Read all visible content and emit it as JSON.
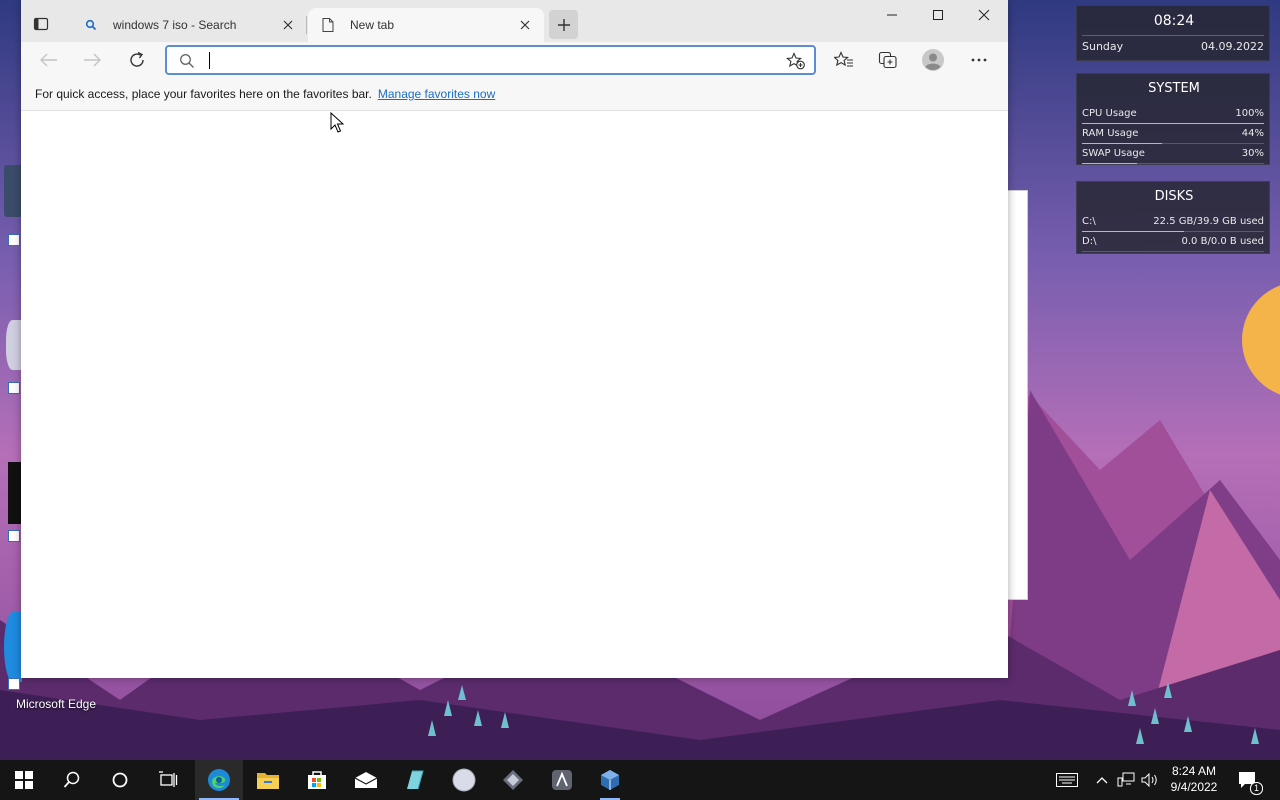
{
  "browser": {
    "tabs": [
      {
        "title": "windows 7 iso - Search",
        "icon": "search-icon"
      },
      {
        "title": "New tab",
        "icon": "page-icon"
      }
    ],
    "address": {
      "value": "",
      "placeholder": ""
    },
    "favorites_bar": {
      "message": "For quick access, place your favorites here on the favorites bar.",
      "link": "Manage favorites now"
    },
    "accent": "#5b8ed0"
  },
  "widgets": {
    "clock": {
      "time": "08:24",
      "day": "Sunday",
      "date": "04.09.2022"
    },
    "system": {
      "title": "SYSTEM",
      "rows": [
        {
          "label": "CPU Usage",
          "value": "100%",
          "level": 1.0
        },
        {
          "label": "RAM Usage",
          "value": "44%",
          "level": 0.44
        },
        {
          "label": "SWAP Usage",
          "value": "30%",
          "level": 0.3
        }
      ]
    },
    "disks": {
      "title": "DISKS",
      "rows": [
        {
          "label": "C:\\",
          "value": "22.5 GB/39.9 GB used",
          "level": 0.56
        },
        {
          "label": "D:\\",
          "value": "0.0 B/0.0 B used",
          "level": 0.0
        }
      ]
    }
  },
  "desktop": {
    "edge_label": "Microsoft Edge"
  },
  "taskbar": {
    "pinned": [
      "start-icon",
      "search-icon",
      "cortana-icon",
      "task-view-icon",
      "edge-icon",
      "file-explorer-icon",
      "store-icon",
      "mail-icon",
      "app-icon",
      "disc-icon",
      "app-icon",
      "app-icon",
      "virtualbox-icon"
    ],
    "clock": {
      "time": "8:24 AM",
      "date": "9/4/2022"
    },
    "notification_count": "1"
  }
}
